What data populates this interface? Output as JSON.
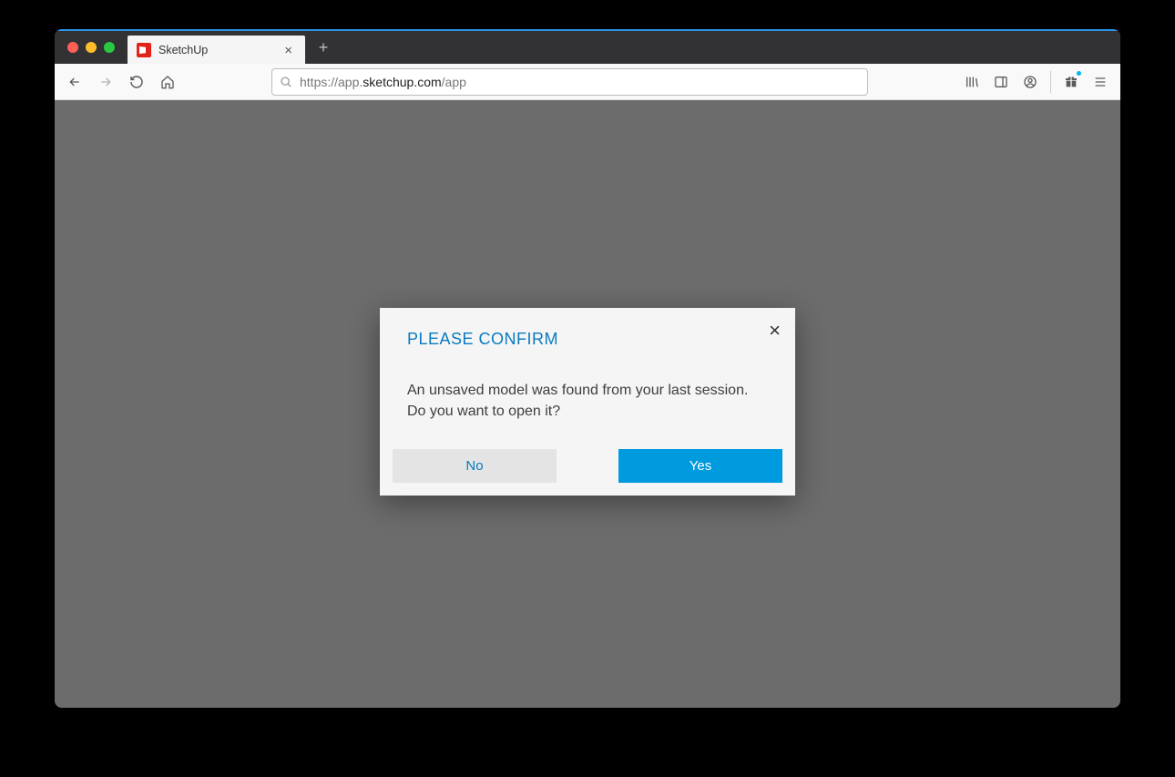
{
  "browser": {
    "tab": {
      "title": "SketchUp"
    },
    "url": {
      "prefix": "https://app.",
      "domain": "sketchup.com",
      "path": "/app"
    }
  },
  "modal": {
    "title": "PLEASE CONFIRM",
    "message_line1": "An unsaved model was found from your last session.",
    "message_line2": "Do you want to open it?",
    "no_label": "No",
    "yes_label": "Yes"
  }
}
